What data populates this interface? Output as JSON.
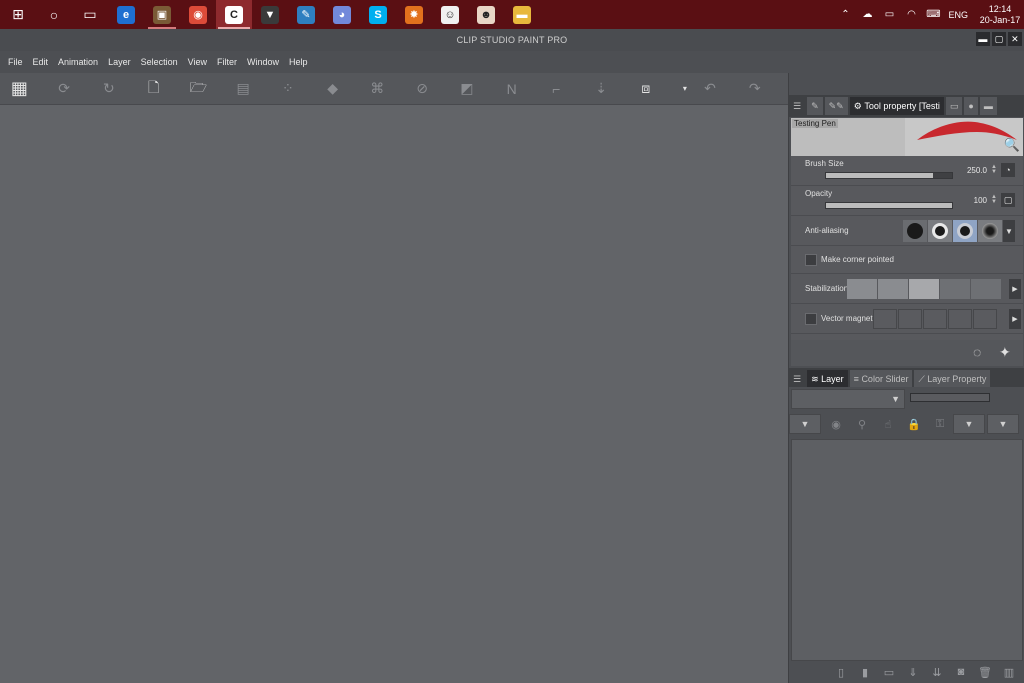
{
  "taskbar": {
    "apps": [
      {
        "name": "windows-start-icon",
        "glyph": "⊞",
        "bg": "",
        "state": ""
      },
      {
        "name": "cortana-icon",
        "glyph": "○",
        "bg": "",
        "state": ""
      },
      {
        "name": "task-view-icon",
        "glyph": "▭",
        "bg": "",
        "state": ""
      },
      {
        "name": "edge-icon",
        "glyph": "e",
        "bg": "#1f6fd1",
        "state": ""
      },
      {
        "name": "photo-app-icon",
        "glyph": "▣",
        "bg": "#7a5a36",
        "state": "running"
      },
      {
        "name": "chrome-icon",
        "glyph": "◉",
        "bg": "#dd4b39",
        "state": ""
      },
      {
        "name": "clip-studio-icon",
        "glyph": "C",
        "bg": "#ffffff",
        "state": "active"
      },
      {
        "name": "fox-app-icon",
        "glyph": "▼",
        "bg": "#3a3a3a",
        "state": ""
      },
      {
        "name": "pen-app-icon",
        "glyph": "✎",
        "bg": "#2f7fc0",
        "state": ""
      },
      {
        "name": "discord-icon",
        "glyph": "◕",
        "bg": "#7289da",
        "state": ""
      },
      {
        "name": "skype-icon",
        "glyph": "S",
        "bg": "#00aff0",
        "state": ""
      },
      {
        "name": "xnview-icon",
        "glyph": "✸",
        "bg": "#e2711d",
        "state": ""
      },
      {
        "name": "emoji-app-icon",
        "glyph": "☺",
        "bg": "#f0f0f0",
        "state": ""
      },
      {
        "name": "avatar-app-icon",
        "glyph": "☻",
        "bg": "#e9d6c6",
        "state": ""
      },
      {
        "name": "file-explorer-icon",
        "glyph": "▬",
        "bg": "#e8b83c",
        "state": ""
      }
    ],
    "tray_lang": "ENG",
    "clock_time": "12:14",
    "clock_date": "20-Jan-17"
  },
  "window": {
    "title": "CLIP STUDIO PAINT PRO"
  },
  "menu": [
    "File",
    "Edit",
    "Animation",
    "Layer",
    "Selection",
    "View",
    "Filter",
    "Window",
    "Help"
  ],
  "tool_panel": {
    "tab_label": "Tool property [Testi",
    "preview_name": "Testing Pen",
    "stroke_color": "#c8282e",
    "brush_size_label": "Brush Size",
    "brush_size_value": "250.0",
    "brush_size_fill": 0.85,
    "opacity_label": "Opacity",
    "opacity_value": "100",
    "opacity_fill": 1.0,
    "anti_aliasing_label": "Anti-aliasing",
    "make_corner_label": "Make corner pointed",
    "stabilization_label": "Stabilization",
    "vector_magnet_label": "Vector magnet"
  },
  "layer_panel": {
    "tab_layer": "Layer",
    "tab_color_slider": "Color Slider",
    "tab_layer_property": "Layer Property"
  }
}
